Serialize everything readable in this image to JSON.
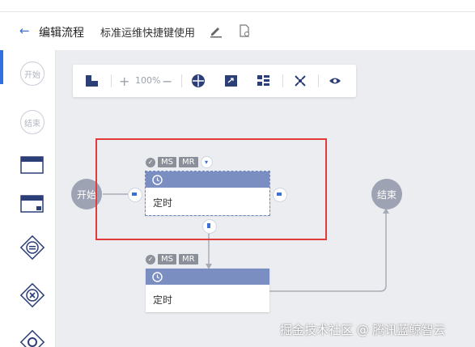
{
  "header": {
    "back_label": "编辑流程",
    "flow_name": "标准运维快捷键使用"
  },
  "toolbar": {
    "zoom": "100%"
  },
  "palette": {
    "items": [
      "开始",
      "结束"
    ]
  },
  "nodes": {
    "start_label": "开始",
    "end_label": "结束",
    "task1": {
      "badges": [
        "MS",
        "MR"
      ],
      "label": "定时"
    },
    "task2": {
      "badges": [
        "MS",
        "MR"
      ],
      "label": "定时"
    }
  },
  "watermark": "掘金技术社区 @ 腾讯蓝鲸智云",
  "colors": {
    "accent": "#2f6fdd",
    "node_header": "#7b8ec2",
    "circle_node": "#9ea3b4",
    "highlight": "#e33b3b"
  }
}
